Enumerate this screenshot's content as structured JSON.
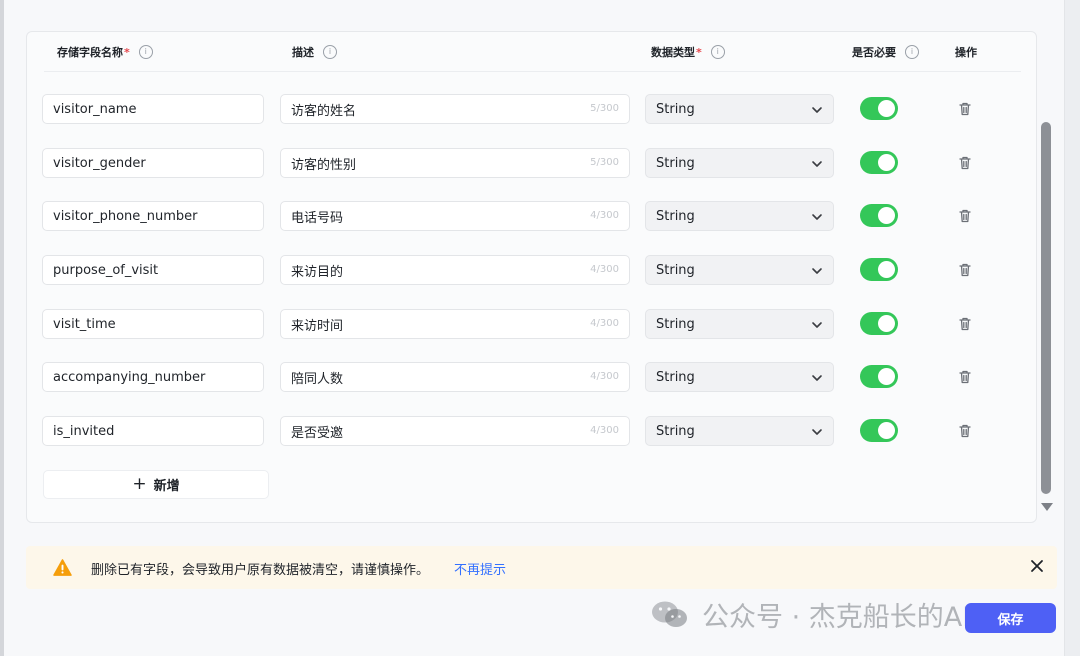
{
  "table": {
    "headers": {
      "field_name": "存储字段名称",
      "description": "描述",
      "data_type": "数据类型",
      "required": "是否必要",
      "actions": "操作"
    },
    "info_glyph": "i",
    "required_mark": "*",
    "rows": [
      {
        "name": "visitor_name",
        "description": "访客的姓名",
        "count": "5/300",
        "type": "String",
        "required": true
      },
      {
        "name": "visitor_gender",
        "description": "访客的性别",
        "count": "5/300",
        "type": "String",
        "required": true
      },
      {
        "name": "visitor_phone_number",
        "description": "电话号码",
        "count": "4/300",
        "type": "String",
        "required": true
      },
      {
        "name": "purpose_of_visit",
        "description": "来访目的",
        "count": "4/300",
        "type": "String",
        "required": true
      },
      {
        "name": "visit_time",
        "description": "来访时间",
        "count": "4/300",
        "type": "String",
        "required": true
      },
      {
        "name": "accompanying_number",
        "description": "陪同人数",
        "count": "4/300",
        "type": "String",
        "required": true
      },
      {
        "name": "is_invited",
        "description": "是否受邀",
        "count": "4/300",
        "type": "String",
        "required": true
      }
    ]
  },
  "add_button": {
    "plus": "+",
    "label": "新增"
  },
  "notice": {
    "text": "删除已有字段，会导致用户原有数据被清空，请谨慎操作。",
    "link": "不再提示"
  },
  "save_button": "保存",
  "watermark": "公众号 · 杰克船长的AIGC",
  "colors": {
    "toggle_on": "#34c759",
    "primary": "#4e60f5",
    "link": "#3370ff",
    "warning": "#f59e0b",
    "notice_bg": "#fdf7ea"
  }
}
